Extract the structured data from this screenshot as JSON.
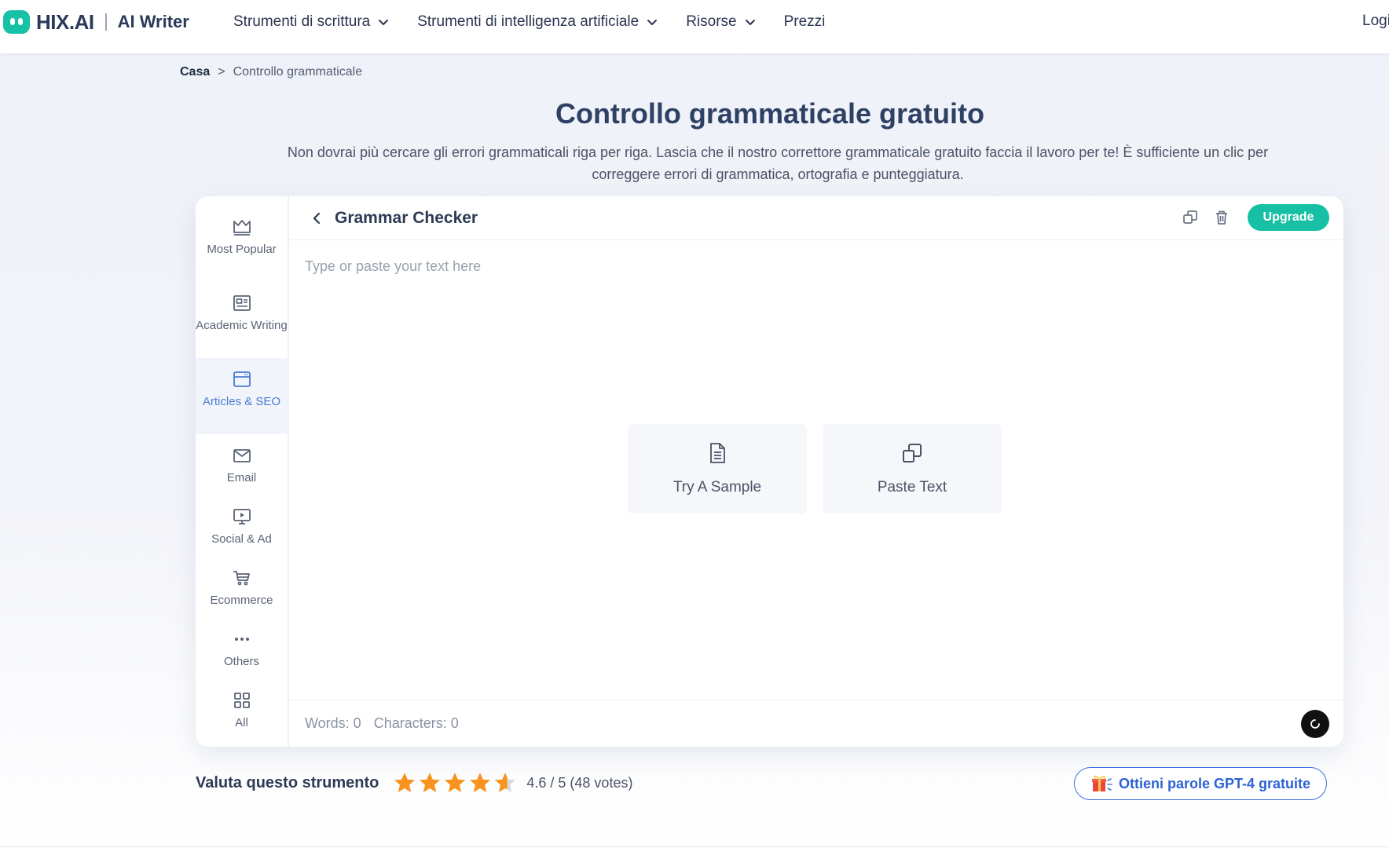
{
  "nav": {
    "logo_text": "HIX.AI",
    "logo_sub": "AI Writer",
    "items": [
      {
        "label": "Strumenti di scrittura",
        "has_dropdown": true
      },
      {
        "label": "Strumenti di intelligenza artificiale",
        "has_dropdown": true
      },
      {
        "label": "Risorse",
        "has_dropdown": true
      },
      {
        "label": "Prezzi",
        "has_dropdown": false
      }
    ],
    "login_label": "Logi"
  },
  "breadcrumb": {
    "home": "Casa",
    "separator": ">",
    "current": "Controllo grammaticale"
  },
  "hero": {
    "title": "Controllo grammaticale gratuito",
    "description": "Non dovrai più cercare gli errori grammaticali riga per riga. Lascia che il nostro correttore grammaticale gratuito faccia il lavoro per te! È sufficiente un clic per correggere errori di grammatica, ortografia e punteggiatura."
  },
  "sidebar": {
    "items": [
      {
        "label": "Most Popular",
        "icon": "crown-icon",
        "active": false
      },
      {
        "label": "Academic Writing",
        "icon": "newspaper-icon",
        "active": false
      },
      {
        "label": "Articles & SEO",
        "icon": "browser-window-icon",
        "active": true
      },
      {
        "label": "Email",
        "icon": "envelope-icon",
        "active": false
      },
      {
        "label": "Social & Ad",
        "icon": "monitor-play-icon",
        "active": false
      },
      {
        "label": "Ecommerce",
        "icon": "cart-icon",
        "active": false
      },
      {
        "label": "Others",
        "icon": "ellipsis-icon",
        "active": false
      },
      {
        "label": "All",
        "icon": "grid-icon",
        "active": false
      }
    ]
  },
  "tool": {
    "title": "Grammar Checker",
    "upgrade_label": "Upgrade",
    "editor_placeholder": "Type or paste your text here",
    "sample_label": "Try A Sample",
    "paste_label": "Paste Text",
    "words_text": "Words: 0",
    "chars_text": "Characters: 0"
  },
  "rating": {
    "label": "Valuta questo strumento",
    "score": 4.6,
    "max": 5,
    "value_text": "4.6 / 5 (48 votes)"
  },
  "promo": {
    "label": "Ottieni parole GPT-4 gratuite"
  },
  "colors": {
    "accent": "#17c0a4",
    "link_blue": "#2d62d4",
    "star": "#f7931e",
    "title": "#2e4063"
  }
}
